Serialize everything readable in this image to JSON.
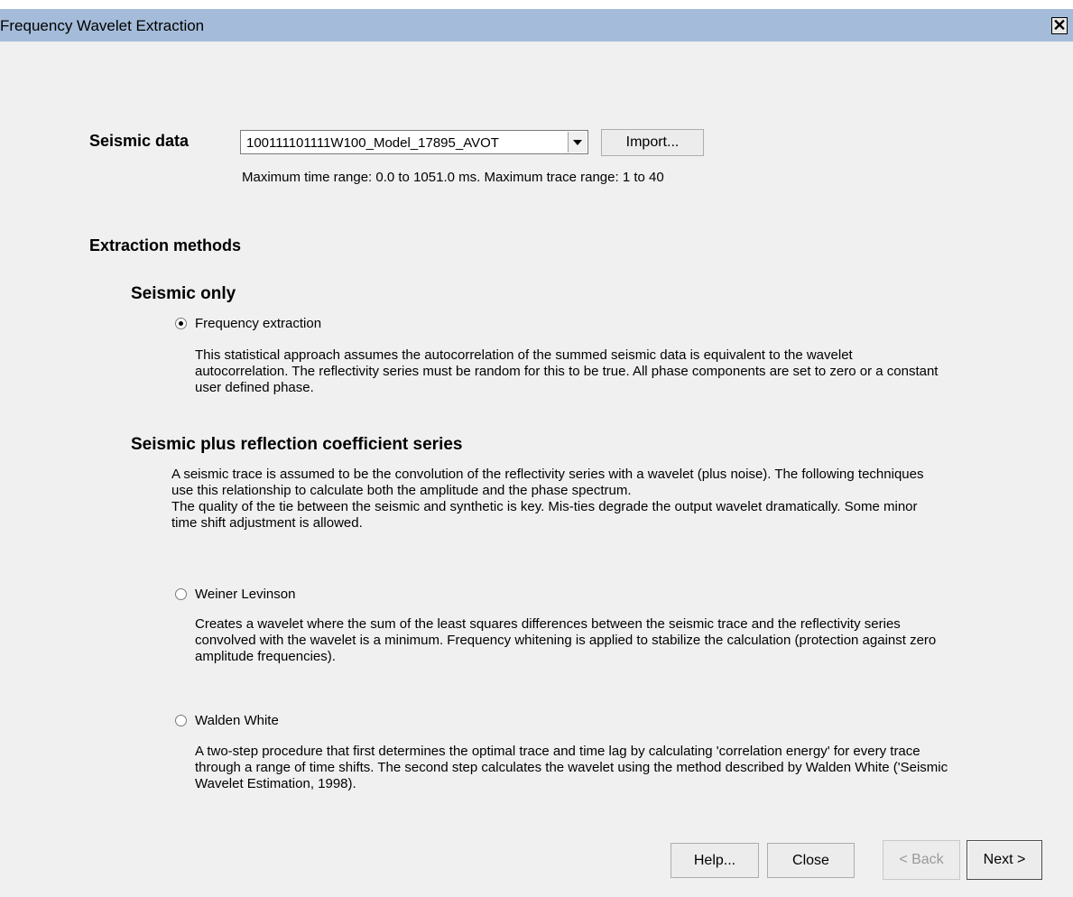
{
  "window": {
    "title": "Frequency Wavelet Extraction",
    "close_glyph": "✕"
  },
  "seismic": {
    "label": "Seismic data",
    "selected_value": "100111101111W100_Model_17895_AVOT",
    "import_label": "Import...",
    "range_info": "Maximum time range: 0.0 to 1051.0 ms. Maximum trace range: 1 to 40"
  },
  "extraction": {
    "heading": "Extraction methods",
    "seismic_only": {
      "heading": "Seismic only",
      "option_label": "Frequency extraction",
      "option_selected": true,
      "description": "This statistical approach assumes the autocorrelation of the summed seismic data is equivalent to the wavelet autocorrelation. The reflectivity series must be random for this to be true. All phase components are set to zero or a constant user defined phase."
    },
    "reflection": {
      "heading": "Seismic plus reflection coefficient series",
      "intro_line1": "A seismic trace is assumed to be the convolution of the reflectivity series with a wavelet (plus noise). The following techniques use this relationship to calculate both the amplitude and the phase spectrum.",
      "intro_line2": "The quality of the tie between the seismic and synthetic is key. Mis-ties degrade the output wavelet dramatically. Some minor time shift adjustment is allowed.",
      "weiner": {
        "label": "Weiner Levinson",
        "selected": false,
        "description": "Creates a wavelet where the sum of the least squares differences between the seismic trace and the reflectivity series convolved with the wavelet is a minimum. Frequency whitening is applied to stabilize the calculation (protection against zero amplitude frequencies)."
      },
      "walden": {
        "label": "Walden White",
        "selected": false,
        "description": "A two-step procedure that first determines the optimal trace and time lag by calculating 'correlation energy' for every trace through a range of time shifts.  The second step calculates the wavelet using the method described by Walden White ('Seismic Wavelet Estimation, 1998)."
      }
    }
  },
  "footer": {
    "help_label": "Help...",
    "close_label": "Close",
    "back_label": "< Back",
    "next_label": "Next >"
  }
}
